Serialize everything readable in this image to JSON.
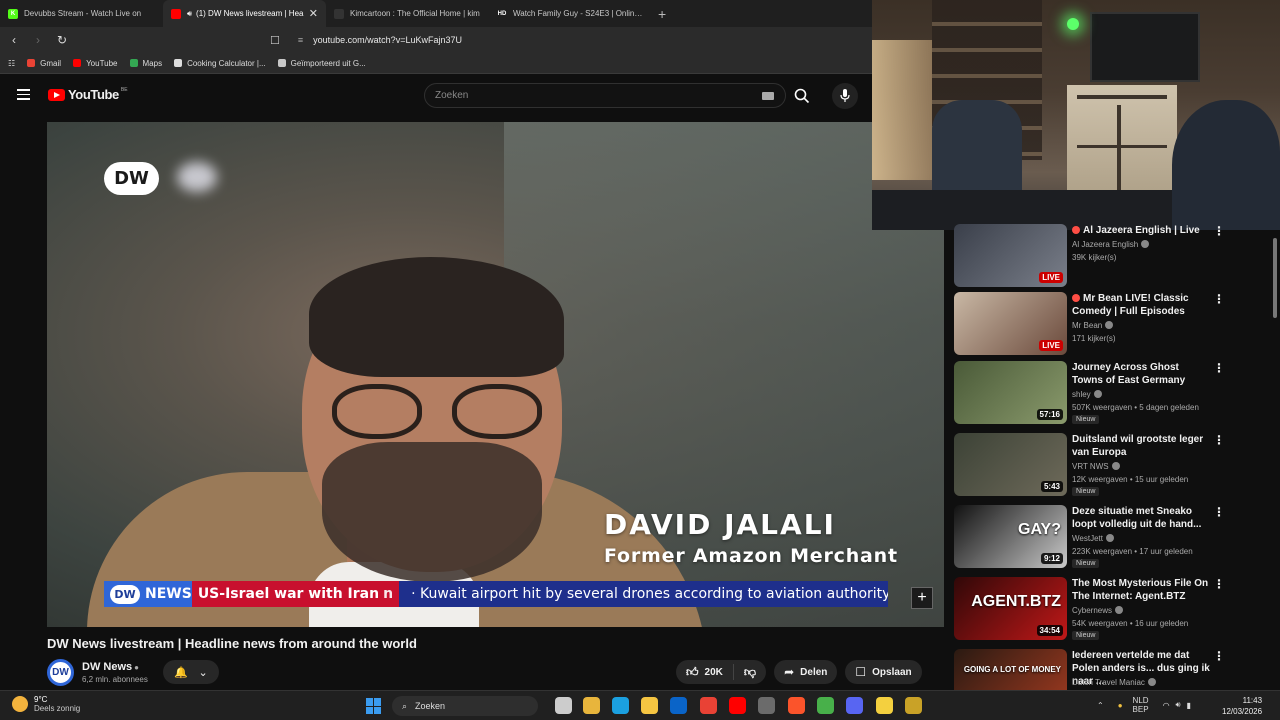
{
  "browser": {
    "tabs": [
      {
        "title": "Devubbs Stream - Watch Live on",
        "favicon": "kick-icon",
        "color": "#53fc18",
        "letter": "K"
      },
      {
        "title": "(1) DW News livestream | Hea",
        "favicon": "youtube-icon",
        "color": "#ff0000",
        "letter": "",
        "active": true
      },
      {
        "title": "Kimcartoon : The Official Home | kim",
        "favicon": "kimcartoon-icon",
        "color": "#333333",
        "letter": ""
      },
      {
        "title": "Watch Family Guy - S24E3 | Online H",
        "favicon": "hd-icon",
        "color": "#1f1f1f",
        "letter": "HD"
      }
    ],
    "new_tab": "+",
    "close": "✕",
    "url": "youtube.com/watch?v=LuKwFajn37U",
    "bookmarks": [
      {
        "label": "Gmail",
        "color": "#ea4335"
      },
      {
        "label": "YouTube",
        "color": "#ff0000"
      },
      {
        "label": "Maps",
        "color": "#34a853"
      },
      {
        "label": "Cooking Calculator |...",
        "color": "#dddddd"
      },
      {
        "label": "Geïmporteerd uit G...",
        "color": "#c8c8c8"
      }
    ]
  },
  "youtube": {
    "logo_text": "YouTube",
    "country_code": "BE",
    "search_placeholder": "Zoeken"
  },
  "video": {
    "logo": "DW",
    "lower_third_name": "DAVID JALALI",
    "lower_third_role": "Former Amazon Merchant",
    "ticker_brand_logo": "DW",
    "ticker_brand": "NEWS",
    "ticker_topic": "US-Israel war with Iran",
    "ticker_topic_tail": "n",
    "ticker_text": "·  Kuwait airport hit by several drones according to aviation authority  ·  T",
    "expand_button": "+",
    "title": "DW News livestream | Headline news from around the world",
    "channel_name": "DW News",
    "channel_avatar": "DW",
    "subscribers": "6,2 mln. abonnees",
    "likes": "20K",
    "share_label": "Delen",
    "save_label": "Opslaan",
    "more_label": "•••"
  },
  "recommendations": [
    {
      "title": "Al Jazeera English | Live",
      "live_dot": true,
      "channel": "Al Jazeera English",
      "meta": "39K kijker(s)",
      "badge": "LIVE",
      "badge_live": true,
      "new": "",
      "colors": [
        "#3a3f4a",
        "#7a7f8a"
      ]
    },
    {
      "title": "Mr Bean LIVE! Classic Comedy | Full Episodes",
      "live_dot": true,
      "channel": "Mr Bean",
      "meta": "171 kijker(s)",
      "badge": "LIVE",
      "badge_live": true,
      "new": "",
      "colors": [
        "#c9b8a5",
        "#6b4a3c"
      ]
    },
    {
      "title": "Journey Across Ghost Towns of East Germany",
      "live_dot": false,
      "channel": "shley",
      "meta": "507K weergaven • 5 dagen geleden",
      "badge": "57:16",
      "badge_live": false,
      "new": "Nieuw",
      "colors": [
        "#4a5a38",
        "#8a9a6c"
      ]
    },
    {
      "title": "Duitsland wil grootste leger van Europa",
      "live_dot": false,
      "channel": "VRT NWS",
      "meta": "12K weergaven • 15 uur geleden",
      "badge": "5:43",
      "badge_live": false,
      "new": "Nieuw",
      "colors": [
        "#3c4236",
        "#6e6a5a"
      ]
    },
    {
      "title": "Deze situatie met Sneako loopt volledig uit de hand...",
      "live_dot": false,
      "channel": "WestJett",
      "meta": "223K weergaven • 17 uur geleden",
      "badge": "9:12",
      "badge_live": false,
      "new": "Nieuw",
      "colors": [
        "#111111",
        "#c9c9c9"
      ]
    },
    {
      "title": "The Most Mysterious File On The Internet: Agent.BTZ",
      "live_dot": false,
      "channel": "Cybernews",
      "meta": "54K weergaven • 16 uur geleden",
      "badge": "34:54",
      "badge_live": false,
      "new": "Nieuw",
      "colors": [
        "#300808",
        "#c01818"
      ]
    },
    {
      "title": "Iedereen vertelde me dat Polen anders is... dus ging ik naar ...",
      "live_dot": false,
      "channel": "Dutch Travel Maniac",
      "meta": "",
      "badge": "",
      "badge_live": false,
      "new": "",
      "colors": [
        "#2a1a12",
        "#a03a20"
      ]
    }
  ],
  "rec_thumb_texts": [
    "",
    "",
    "",
    "",
    "GAY?",
    "AGENT.BTZ",
    "GOING A LOT OF MONEY"
  ],
  "taskbar": {
    "temp": "9°C",
    "weather": "Deels zonnig",
    "search": "Zoeken",
    "lang1": "NLD",
    "lang2": "BEP",
    "time": "11:43",
    "date": "12/03/2026"
  }
}
